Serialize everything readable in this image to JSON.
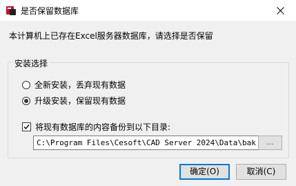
{
  "window": {
    "title": "是否保留数据库",
    "close_icon": "close-icon",
    "app_icon": "app-logo-icon"
  },
  "message": "本计算机上已存在Excel服务器数据库，请选择是否保留",
  "install_group": {
    "legend": "安装选择",
    "options": [
      {
        "label": "全新安装，丢弃现有数据",
        "checked": false
      },
      {
        "label": "升级安装，保留现有数据",
        "checked": true
      }
    ]
  },
  "backup": {
    "checkbox_label": "将现有数据库的内容备份到以下目录:",
    "checked": true,
    "path_value": "C:\\Program Files\\Cesoft\\CAD Server 2024\\Data\\bak",
    "browse_label": "..."
  },
  "buttons": {
    "ok_label": "确定(O)",
    "cancel_label": "取消(C)"
  },
  "colors": {
    "titlebar": "#ffffff",
    "dialog_bg": "#f0f0f0",
    "default_button_border": "#0078d7",
    "icon_red": "#c8102e"
  }
}
